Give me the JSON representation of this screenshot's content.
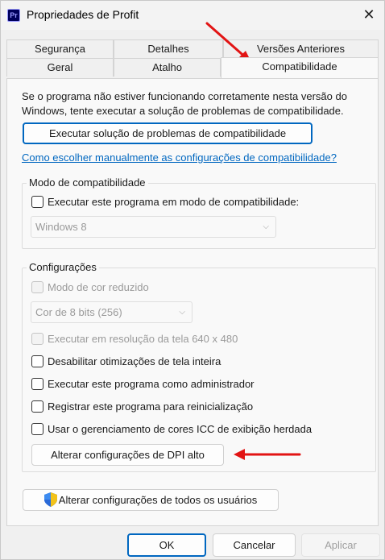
{
  "window": {
    "title": "Propriedades de Profit",
    "app_icon_text": "Pr",
    "close_glyph": "✕"
  },
  "tabs": {
    "row1": [
      "Segurança",
      "Detalhes",
      "Versões Anteriores"
    ],
    "row2": [
      "Geral",
      "Atalho",
      "Compatibilidade"
    ],
    "active": "Compatibilidade"
  },
  "main": {
    "description": "Se o programa não estiver funcionando corretamente nesta versão do Windows, tente executar a solução de problemas de compatibilidade.",
    "troubleshoot_button": "Executar solução de problemas de compatibilidade",
    "manual_link": "Como escolher manualmente as configurações de compatibilidade?"
  },
  "compat_mode": {
    "group_label": "Modo de compatibilidade",
    "checkbox_label": "Executar este programa em modo de compatibilidade:",
    "checked": false,
    "os_select": "Windows 8"
  },
  "settings": {
    "group_label": "Configurações",
    "reduced_color": {
      "label": "Modo de cor reduzido",
      "enabled": false,
      "checked": false
    },
    "color_select": "Cor de 8 bits (256)",
    "res_640": {
      "label": "Executar em resolução da tela 640 x 480",
      "enabled": false,
      "checked": false
    },
    "disable_fullscreen": {
      "label": "Desabilitar otimizações de tela inteira",
      "enabled": true,
      "checked": false
    },
    "run_admin": {
      "label": "Executar este programa como administrador",
      "enabled": true,
      "checked": false
    },
    "register_restart": {
      "label": "Registrar este programa para reinicialização",
      "enabled": true,
      "checked": false
    },
    "legacy_icc": {
      "label": "Usar o gerenciamento de cores ICC de exibição herdada",
      "enabled": true,
      "checked": false
    },
    "dpi_button": "Alterar configurações de DPI alto"
  },
  "all_users_button": "Alterar configurações de todos os usuários",
  "footer": {
    "ok": "OK",
    "cancel": "Cancelar",
    "apply": "Aplicar"
  },
  "annotation_color": "#e21414"
}
